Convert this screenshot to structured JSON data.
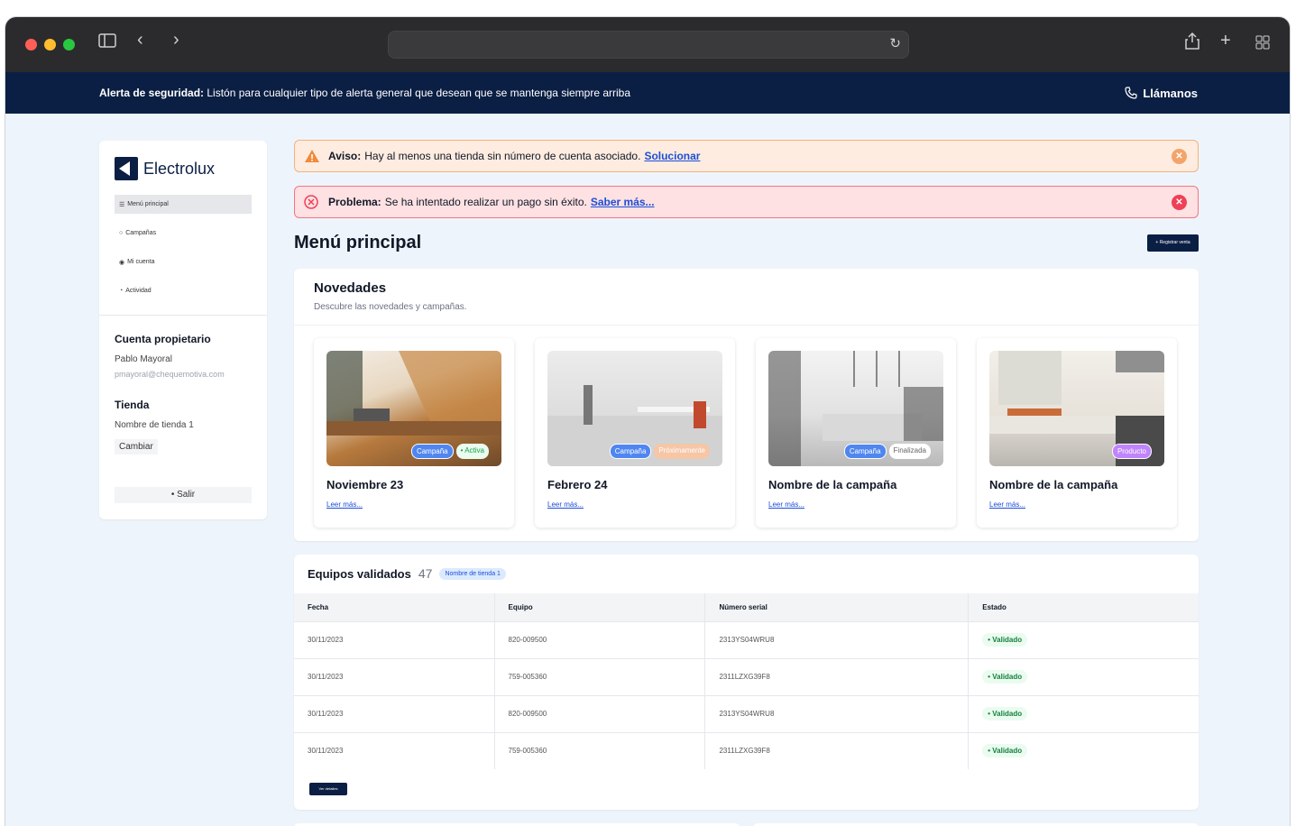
{
  "browser": {
    "url": ""
  },
  "alert_bar": {
    "label": "Alerta de seguridad:",
    "message": " Listón para cualquier tipo de alerta general que desean que se mantenga siempre arriba",
    "call_label": "Llámanos"
  },
  "sidebar": {
    "logo_text": "Electrolux",
    "nav": [
      {
        "label": "Menú principal",
        "icon": "grid-icon",
        "active": true
      },
      {
        "label": "Campañas",
        "icon": "circle-icon",
        "active": false
      },
      {
        "label": "Mi cuenta",
        "icon": "user-circle-icon",
        "active": false
      },
      {
        "label": "Actividad",
        "icon": "activity-icon",
        "active": false
      }
    ],
    "account": {
      "heading": "Cuenta propietario",
      "name": "Pablo Mayoral",
      "email": "pmayoral@chequemotiva.com"
    },
    "store": {
      "heading": "Tienda",
      "name": "Nombre de tienda 1",
      "change_label": "Cambiar"
    },
    "logout_label": "• Salir"
  },
  "banners": {
    "warning": {
      "label": "Aviso:",
      "text": "Hay al menos una tienda sin número de cuenta asociado.",
      "link": "Solucionar",
      "color": "#f3a46a"
    },
    "error": {
      "label": "Problema:",
      "text": "Se ha intentado realizar un pago sin éxito.",
      "link": "Saber más...",
      "color": "#ef4056"
    }
  },
  "page": {
    "title": "Menú principal",
    "register_button": "+ Registrar venta"
  },
  "news": {
    "title": "Novedades",
    "subtitle": "Descubre las novedades y campañas.",
    "items": [
      {
        "title": "Noviembre 23",
        "link": "Leer más...",
        "tags": [
          "Campaña",
          "• Activa"
        ]
      },
      {
        "title": "Febrero 24",
        "link": "Leer más...",
        "tags": [
          "Campaña",
          "Próximamente"
        ]
      },
      {
        "title": "Nombre de la campaña",
        "link": "Leer más...",
        "tags": [
          "Campaña",
          "Finalizada"
        ]
      },
      {
        "title": "Nombre de la campaña",
        "link": "Leer más...",
        "tags": [
          "Producto"
        ]
      }
    ]
  },
  "equipment": {
    "title": "Equipos validados",
    "count": "47",
    "store_tag": "Nombre de tienda 1",
    "columns": [
      "Fecha",
      "Equipo",
      "Número serial",
      "Estado"
    ],
    "rows": [
      [
        "30/11/2023",
        "820-009500",
        "2313YS04WRU8",
        "• Validado"
      ],
      [
        "30/11/2023",
        "759-005360",
        "2311LZXG39F8",
        "• Validado"
      ],
      [
        "30/11/2023",
        "820-009500",
        "2313YS04WRU8",
        "• Validado"
      ],
      [
        "30/11/2023",
        "759-005360",
        "2311LZXG39F8",
        "• Validado"
      ]
    ],
    "details_button": "Ver detalles"
  },
  "colors": {
    "navy": "#0b1f44",
    "background": "#eef4fb"
  }
}
